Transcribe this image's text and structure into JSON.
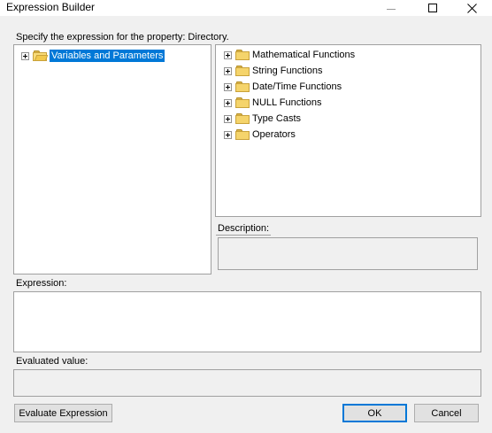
{
  "window": {
    "title": "Expression Builder"
  },
  "prompt": "Specify the expression for the property: Directory.",
  "variables_tree": {
    "items": [
      {
        "label": "Variables and Parameters",
        "selected": true,
        "expanded_icon": "folder-open-icon"
      }
    ]
  },
  "functions_tree": {
    "items": [
      {
        "label": "Mathematical Functions"
      },
      {
        "label": "String Functions"
      },
      {
        "label": "Date/Time Functions"
      },
      {
        "label": "NULL Functions"
      },
      {
        "label": "Type Casts"
      },
      {
        "label": "Operators"
      }
    ]
  },
  "description": {
    "label": "Description:",
    "value": ""
  },
  "expression": {
    "label": "Expression:",
    "value": ""
  },
  "evaluated_value": {
    "label": "Evaluated value:",
    "value": ""
  },
  "buttons": {
    "evaluate": "Evaluate Expression",
    "ok": "OK",
    "cancel": "Cancel"
  },
  "colors": {
    "selection": "#0078d7",
    "folder": "#f5d46b",
    "background": "#f0f0f0"
  }
}
